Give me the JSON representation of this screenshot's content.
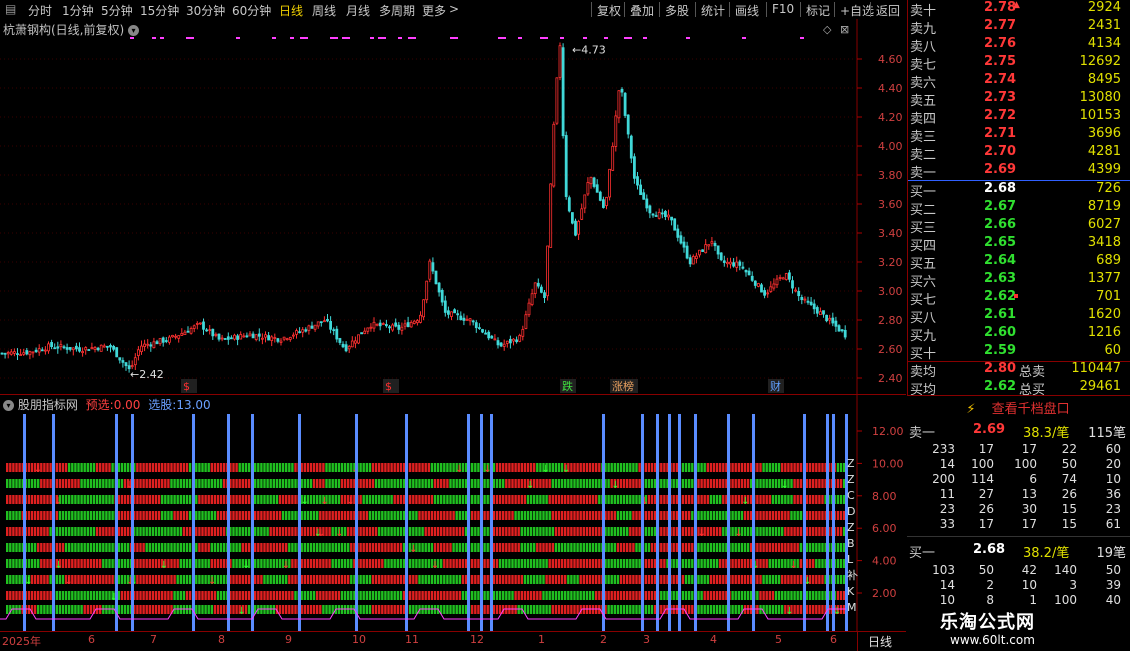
{
  "toolbar": {
    "periods": [
      "分时",
      "1分钟",
      "5分钟",
      "15分钟",
      "30分钟",
      "60分钟",
      "日线",
      "周线",
      "月线",
      "多周期",
      "更多"
    ],
    "active": "日线",
    "actions": [
      "复权",
      "叠加",
      "多股",
      "统计",
      "画线",
      "F10",
      "标记",
      "+自选",
      "返回"
    ]
  },
  "chart": {
    "title": "杭萧钢构(日线,前复权)",
    "high_label": "4.73",
    "low_label": "2.42",
    "y_ticks": [
      "4.60",
      "4.40",
      "4.20",
      "4.00",
      "3.80",
      "3.60",
      "3.40",
      "3.20",
      "3.00",
      "2.80",
      "2.60",
      "2.40"
    ],
    "markers": [
      {
        "text": "$",
        "color": "#ff3030"
      },
      {
        "text": "$",
        "color": "#ff3030"
      },
      {
        "text": "跌",
        "color": "#40e040"
      },
      {
        "text": "涨榜",
        "color": "#e8a060"
      },
      {
        "text": "财",
        "color": "#60a0ff"
      }
    ]
  },
  "indicator": {
    "name": "股朋指标网",
    "pre_label": "预选:",
    "pre_value": "0.00",
    "sel_label": "选股:",
    "sel_value": "13.00",
    "y_ticks": [
      "12.00",
      "10.00",
      "8.00",
      "6.00",
      "4.00",
      "2.00"
    ],
    "letters": [
      "Z",
      "Z",
      "C",
      "D",
      "Z",
      "B",
      "L",
      "补",
      "K",
      "M"
    ]
  },
  "x_axis": {
    "dates": [
      "2025年",
      "6",
      "7",
      "8",
      "9",
      "10",
      "11",
      "12",
      "1",
      "2",
      "3",
      "4",
      "5",
      "6"
    ],
    "period": "日线"
  },
  "orderbook": {
    "asks": [
      {
        "name": "卖十",
        "price": "2.78",
        "vol": "2924"
      },
      {
        "name": "卖九",
        "price": "2.77",
        "vol": "2431"
      },
      {
        "name": "卖八",
        "price": "2.76",
        "vol": "4134"
      },
      {
        "name": "卖七",
        "price": "2.75",
        "vol": "12692"
      },
      {
        "name": "卖六",
        "price": "2.74",
        "vol": "8495"
      },
      {
        "name": "卖五",
        "price": "2.73",
        "vol": "13080"
      },
      {
        "name": "卖四",
        "price": "2.72",
        "vol": "10153"
      },
      {
        "name": "卖三",
        "price": "2.71",
        "vol": "3696"
      },
      {
        "name": "卖二",
        "price": "2.70",
        "vol": "4281"
      },
      {
        "name": "卖一",
        "price": "2.69",
        "vol": "4399"
      }
    ],
    "bids": [
      {
        "name": "买一",
        "price": "2.68",
        "vol": "726",
        "color": "#ffffff"
      },
      {
        "name": "买二",
        "price": "2.67",
        "vol": "8719",
        "color": "#30e030"
      },
      {
        "name": "买三",
        "price": "2.66",
        "vol": "6027",
        "color": "#30e030"
      },
      {
        "name": "买四",
        "price": "2.65",
        "vol": "3418",
        "color": "#30e030"
      },
      {
        "name": "买五",
        "price": "2.64",
        "vol": "689",
        "color": "#30e030"
      },
      {
        "name": "买六",
        "price": "2.63",
        "vol": "1377",
        "color": "#30e030"
      },
      {
        "name": "买七",
        "price": "2.62",
        "vol": "701",
        "color": "#30e030"
      },
      {
        "name": "买八",
        "price": "2.61",
        "vol": "1620",
        "color": "#30e030"
      },
      {
        "name": "买九",
        "price": "2.60",
        "vol": "1216",
        "color": "#30e030"
      },
      {
        "name": "买十",
        "price": "2.59",
        "vol": "60",
        "color": "#30e030"
      }
    ],
    "avg_sell": {
      "name": "卖均",
      "price": "2.80",
      "label": "总卖",
      "vol": "110447"
    },
    "avg_buy": {
      "name": "买均",
      "price": "2.62",
      "label": "总买",
      "vol": "29461"
    }
  },
  "queue": {
    "button": "查看千档盘口",
    "sell1": {
      "name": "卖一",
      "price": "2.69",
      "per": "38.3/笔",
      "count": "115笔"
    },
    "sell_rows": [
      [
        "233",
        "17",
        "17",
        "22",
        "60"
      ],
      [
        "14",
        "100",
        "100",
        "50",
        "20"
      ],
      [
        "200",
        "114",
        "6",
        "74",
        "10"
      ],
      [
        "11",
        "27",
        "13",
        "26",
        "36"
      ],
      [
        "23",
        "26",
        "30",
        "15",
        "23"
      ],
      [
        "33",
        "17",
        "17",
        "15",
        "61"
      ]
    ],
    "buy1": {
      "name": "买一",
      "price": "2.68",
      "per": "38.2/笔",
      "count": "19笔"
    },
    "buy_rows": [
      [
        "103",
        "50",
        "42",
        "140",
        "50"
      ],
      [
        "14",
        "2",
        "10",
        "3",
        "39"
      ],
      [
        "10",
        "8",
        "1",
        "100",
        "40"
      ],
      [
        "5",
        "",
        "",
        "",
        ""
      ]
    ]
  },
  "watermark": {
    "name": "乐淘公式网",
    "url": "www.60lt.com"
  }
}
